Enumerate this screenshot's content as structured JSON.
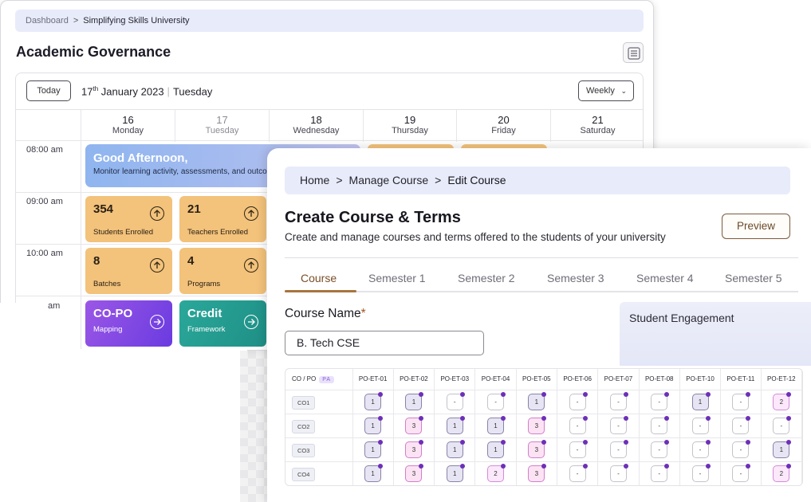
{
  "back": {
    "breadcrumb": {
      "root": "Dashboard",
      "separator": ">",
      "current": "Simplifying Skills University"
    },
    "title": "Academic Governance",
    "calendar": {
      "today_label": "Today",
      "date_day": "17",
      "date_suffix": "th",
      "date_rest": "January 2023",
      "date_weekday": "Tuesday",
      "view_label": "Weekly",
      "days": [
        {
          "num": "16",
          "name": "Monday"
        },
        {
          "num": "17",
          "name": "Tuesday"
        },
        {
          "num": "18",
          "name": "Wednesday"
        },
        {
          "num": "19",
          "name": "Thursday"
        },
        {
          "num": "20",
          "name": "Friday"
        },
        {
          "num": "21",
          "name": "Saturday"
        }
      ],
      "times": [
        "08:00 am",
        "09:00 am",
        "10:00 am",
        "am"
      ],
      "greeting": {
        "title": "Good Afternoon,",
        "text": "Monitor learning activity, assessments, and outco"
      },
      "cards": [
        {
          "value": "354",
          "label": "Students Enrolled"
        },
        {
          "value": "21",
          "label": "Teachers Enrolled"
        },
        {
          "value": "8",
          "label": "Batches"
        },
        {
          "value": "4",
          "label": "Programs"
        },
        {
          "value": "CO-PO",
          "label": "Mapping"
        },
        {
          "value": "Credit",
          "label": "Framework"
        }
      ]
    }
  },
  "front": {
    "breadcrumb": {
      "home": "Home",
      "separator": ">",
      "mid": "Manage Course",
      "current": "Edit Course"
    },
    "title": "Create Course & Terms",
    "subtitle": "Create and manage courses and terms offered to the students of your university",
    "preview_label": "Preview",
    "tabs": [
      "Course",
      "Semester 1",
      "Semester 2",
      "Semester 3",
      "Semester 4",
      "Semester 5"
    ],
    "course_name_label": "Course Name",
    "required_mark": "*",
    "course_name_value": "B. Tech CSE",
    "engagement_label": "Student Engagement",
    "copo": {
      "corner_label": "CO / PO",
      "pa_label": "PA",
      "columns": [
        "PO-ET-01",
        "PO-ET-02",
        "PO-ET-03",
        "PO-ET-04",
        "PO-ET-05",
        "PO-ET-06",
        "PO-ET-07",
        "PO-ET-08",
        "PO-ET-10",
        "PO-ET-11",
        "PO-ET-12"
      ],
      "rows": [
        {
          "co": "CO1",
          "values": [
            "1",
            "1",
            "-",
            "-",
            "1",
            "-",
            "-",
            "-",
            "1",
            "-",
            "2"
          ]
        },
        {
          "co": "CO2",
          "values": [
            "1",
            "3",
            "1",
            "1",
            "3",
            "-",
            "-",
            "-",
            "-",
            "-",
            "-"
          ]
        },
        {
          "co": "CO3",
          "values": [
            "1",
            "3",
            "1",
            "1",
            "3",
            "-",
            "-",
            "-",
            "-",
            "-",
            "1"
          ]
        },
        {
          "co": "CO4",
          "values": [
            "1",
            "3",
            "1",
            "2",
            "3",
            "-",
            "-",
            "-",
            "-",
            "-",
            "2"
          ]
        }
      ]
    }
  }
}
